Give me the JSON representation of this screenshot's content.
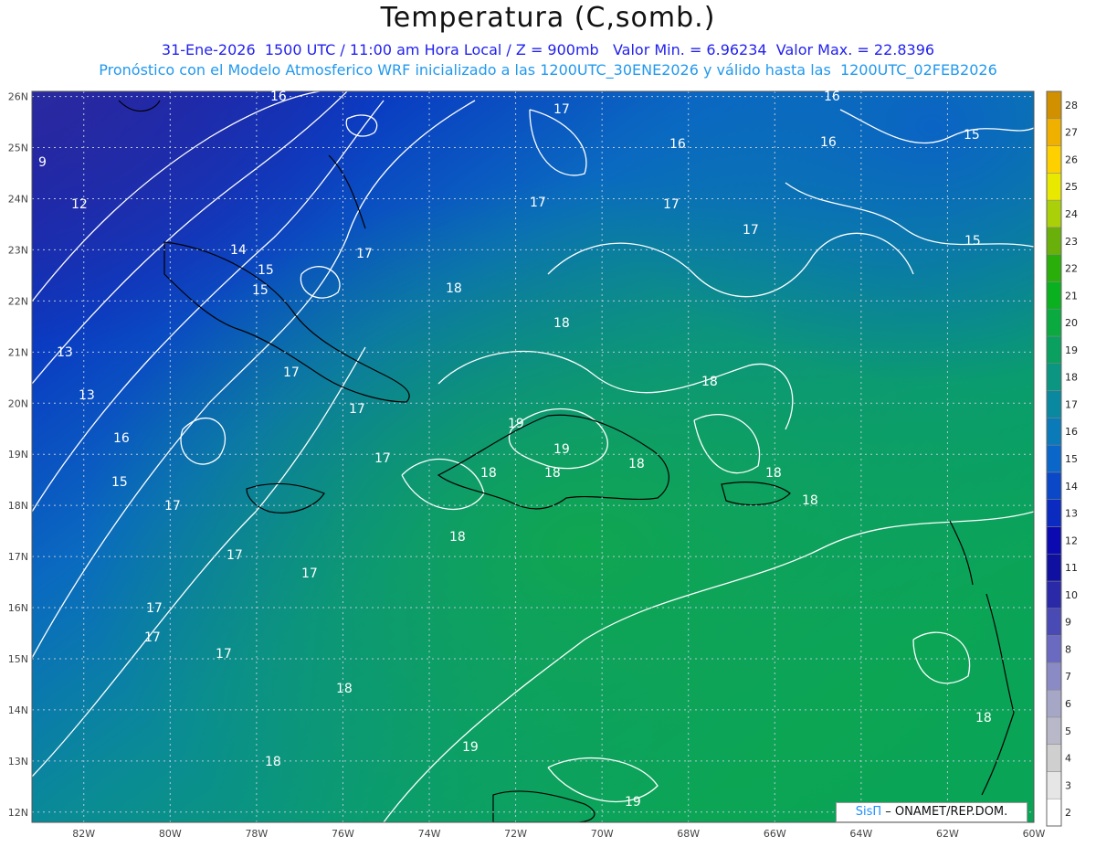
{
  "title": "Temperatura (C,somb.)",
  "subtitle_1": "31-Ene-2026  1500 UTC / 11:00 am Hora Local / Z = 900mb   Valor Min. = 6.96234  Valor Max. = 22.8396",
  "subtitle_2": "Pronóstico con el Modelo Atmosferico WRF inicializado a las 1200UTC_30ENE2026 y válido hasta las  1200UTC_02FEB2026",
  "credit": {
    "brand": "SisΠ",
    "text": " – ONAMET/REP.DOM."
  },
  "map": {
    "lon_range": [
      -83.2,
      -60
    ],
    "lat_range": [
      11.8,
      26.1
    ],
    "lon_ticks": [
      "82W",
      "80W",
      "78W",
      "76W",
      "74W",
      "72W",
      "70W",
      "68W",
      "66W",
      "64W",
      "62W",
      "60W"
    ],
    "lat_ticks": [
      "12N",
      "13N",
      "14N",
      "15N",
      "16N",
      "17N",
      "18N",
      "19N",
      "20N",
      "21N",
      "22N",
      "23N",
      "24N",
      "25N",
      "26N"
    ],
    "grid": true
  },
  "colorbar": {
    "labels": [
      "2",
      "3",
      "4",
      "5",
      "6",
      "7",
      "8",
      "9",
      "10",
      "11",
      "12",
      "13",
      "14",
      "15",
      "16",
      "17",
      "18",
      "19",
      "20",
      "21",
      "22",
      "23",
      "24",
      "25",
      "26",
      "27",
      "28"
    ],
    "colors": [
      "#ffffff",
      "#e6e6e6",
      "#cfcfcf",
      "#b8b8c8",
      "#a6a6c6",
      "#8a8ac4",
      "#6a6ac0",
      "#4a4ab4",
      "#2a2aa8",
      "#1010a0",
      "#0a0ab0",
      "#0a2ac0",
      "#0a48c8",
      "#0a66c8",
      "#0a7ab8",
      "#0a88a0",
      "#0a9680",
      "#0aa060",
      "#0aaa40",
      "#0ab020",
      "#2aae0a",
      "#6ab00a",
      "#aad00a",
      "#e8e800",
      "#ffd000",
      "#f0b000",
      "#d09000"
    ]
  },
  "contour_labels": [
    "9",
    "12",
    "13",
    "13",
    "14",
    "15",
    "15",
    "16",
    "16",
    "16",
    "16",
    "15",
    "15",
    "17",
    "17",
    "17",
    "17",
    "17",
    "17",
    "17",
    "17",
    "17",
    "17",
    "17",
    "17",
    "17",
    "17",
    "18",
    "18",
    "18",
    "18",
    "18",
    "18",
    "18",
    "18",
    "18",
    "18",
    "18",
    "18",
    "19",
    "19",
    "19",
    "19",
    "16",
    "15"
  ]
}
